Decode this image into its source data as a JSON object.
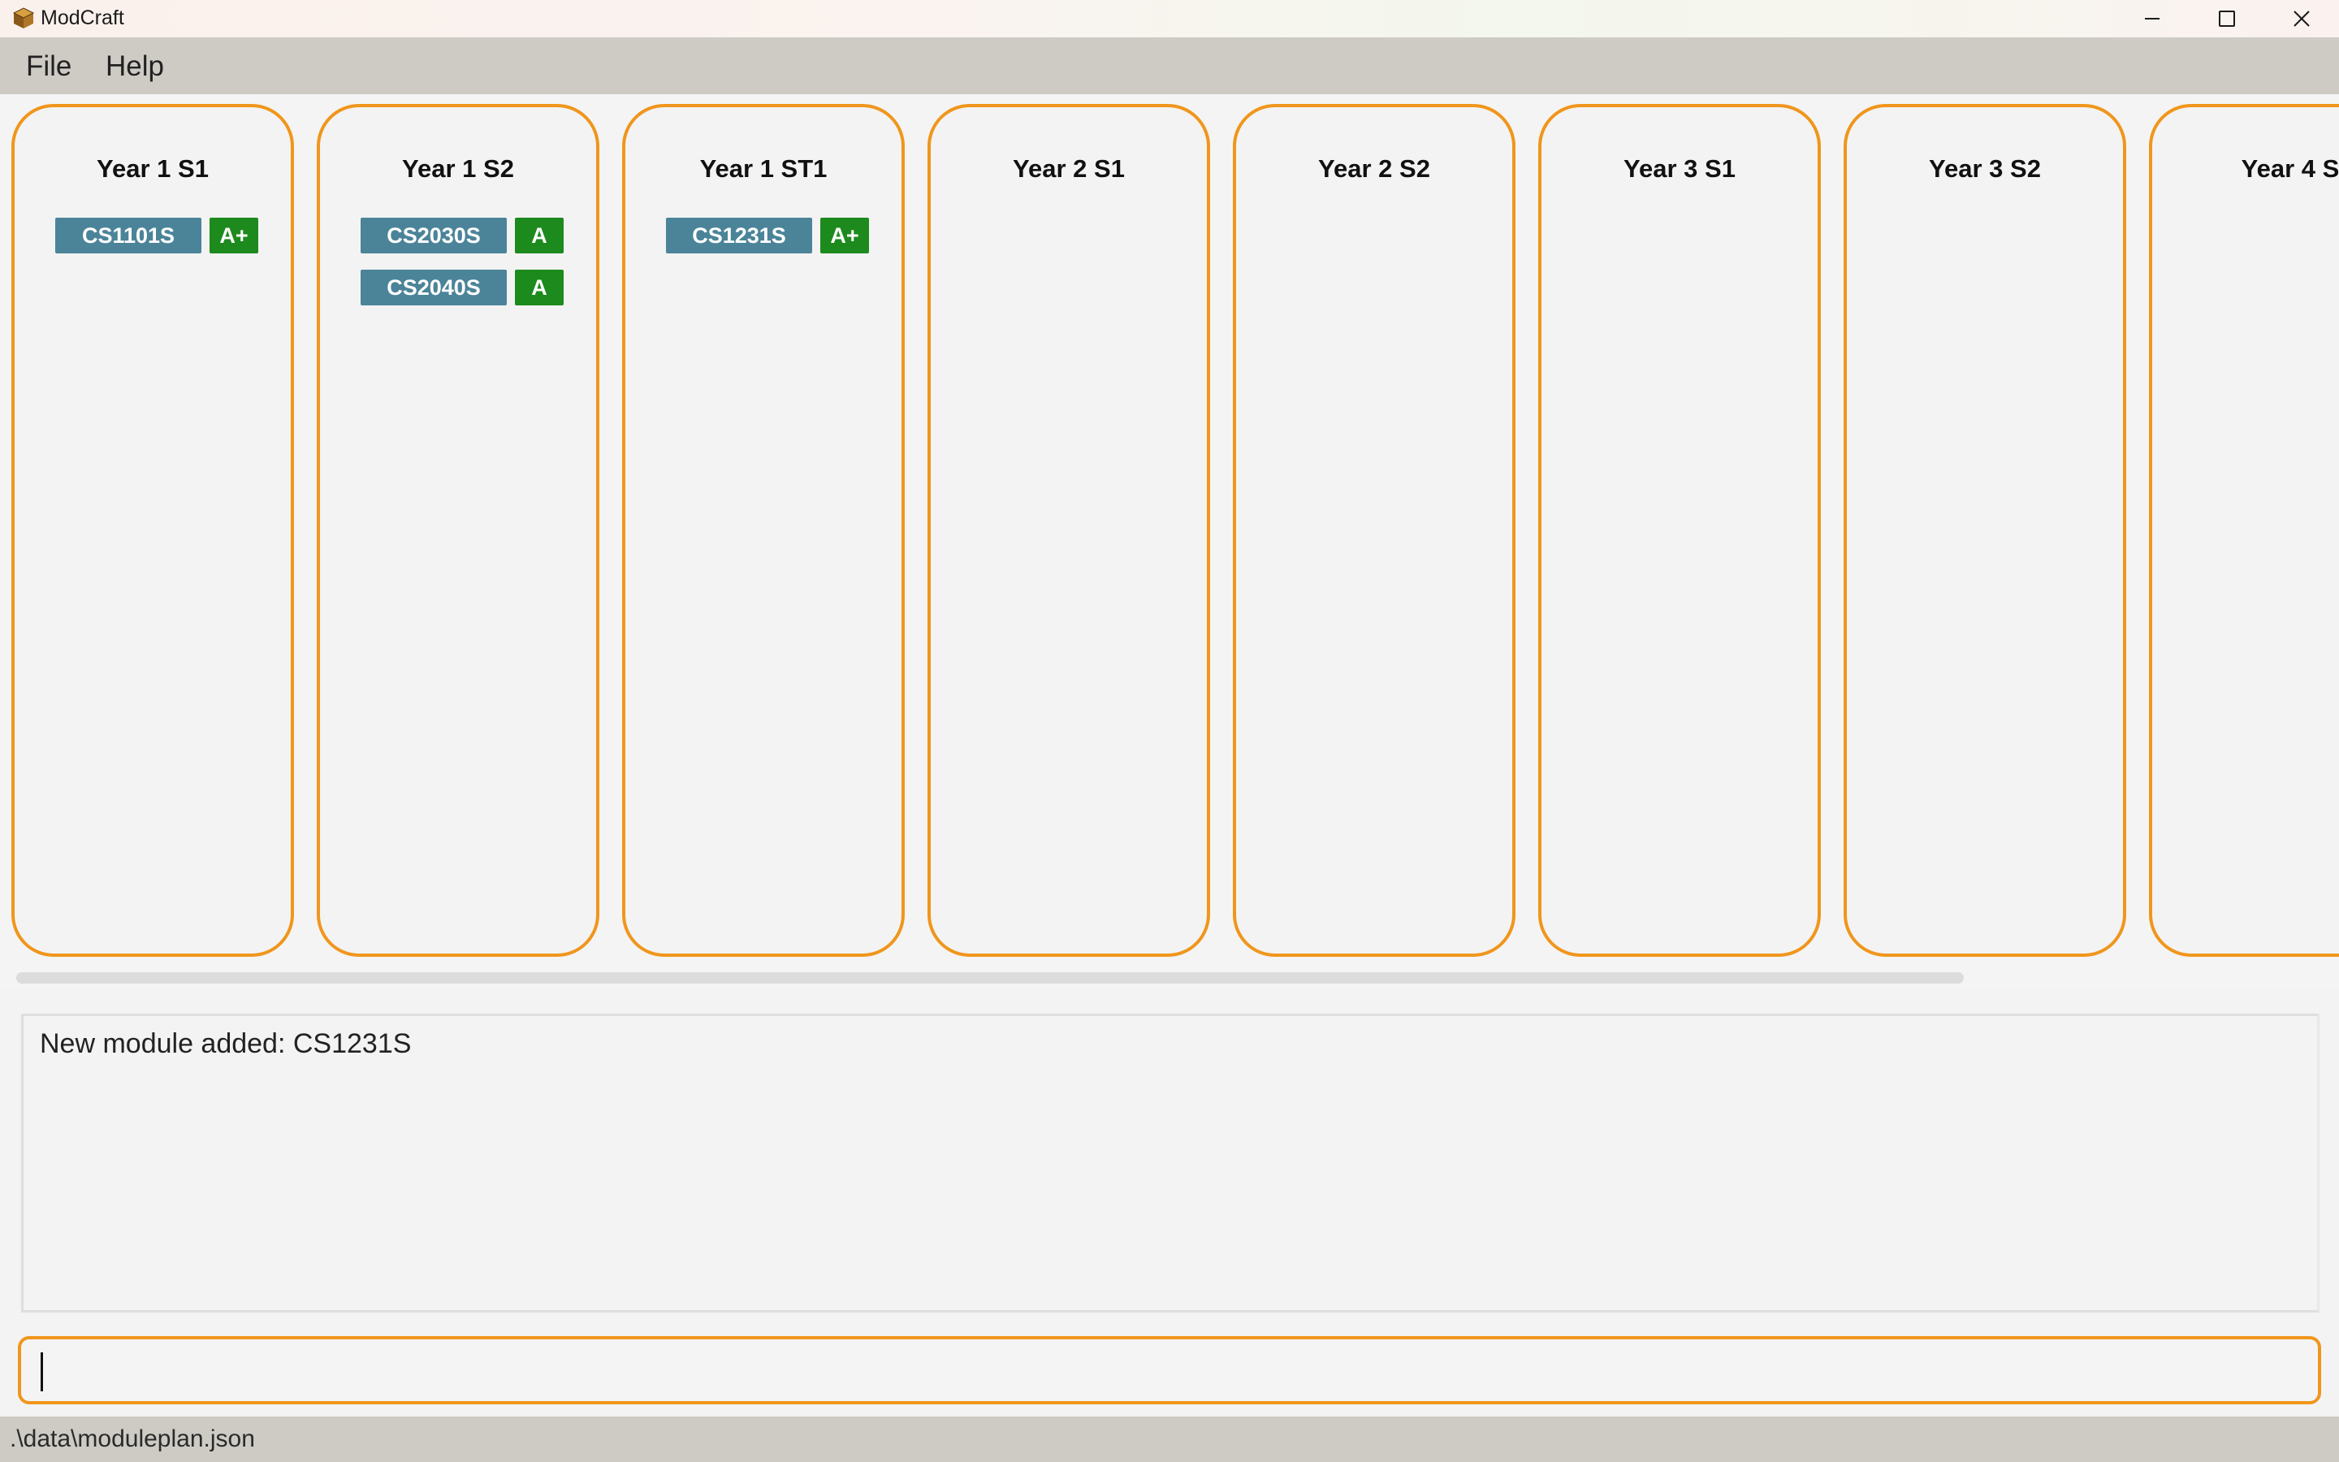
{
  "window": {
    "title": "ModCraft",
    "icon": "modcraft-box-icon"
  },
  "menu": {
    "file_label": "File",
    "help_label": "Help"
  },
  "semesters": [
    {
      "title": "Year 1 S1",
      "modules": [
        {
          "code": "CS1101S",
          "grade": "A+"
        }
      ]
    },
    {
      "title": "Year 1 S2",
      "modules": [
        {
          "code": "CS2030S",
          "grade": "A"
        },
        {
          "code": "CS2040S",
          "grade": "A"
        }
      ]
    },
    {
      "title": "Year 1 ST1",
      "modules": [
        {
          "code": "CS1231S",
          "grade": "A+"
        }
      ]
    },
    {
      "title": "Year 2 S1",
      "modules": []
    },
    {
      "title": "Year 2 S2",
      "modules": []
    },
    {
      "title": "Year 3 S1",
      "modules": []
    },
    {
      "title": "Year 3 S2",
      "modules": []
    },
    {
      "title": "Year 4 S",
      "modules": []
    }
  ],
  "result": {
    "message": "New module added: CS1231S"
  },
  "command": {
    "value": "",
    "placeholder": ""
  },
  "status": {
    "save_path": ".\\data\\moduleplan.json"
  },
  "colors": {
    "accent_orange": "#f0961c",
    "module_code_bg": "#4b8499",
    "grade_bg": "#1d8a1d",
    "bar_bg": "#cecbc5"
  }
}
